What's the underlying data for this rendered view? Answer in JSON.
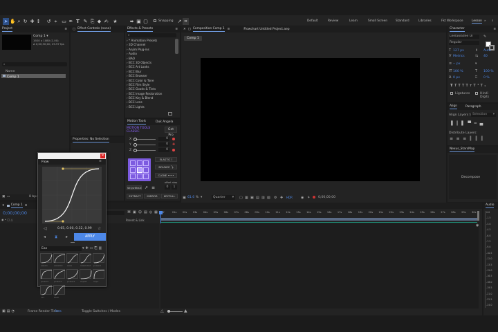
{
  "toolbar": {
    "snapping_label": "Snapping",
    "workspaces": [
      "Default",
      "Review",
      "Learn",
      "Small Screen",
      "Standard",
      "Libraries",
      "Fkt Workspace",
      "Lesson"
    ]
  },
  "project": {
    "title": "Project",
    "comp_name": "Comp 1 ▾",
    "comp_info1": "1920 x 1080 (1.00)",
    "comp_info2": "Δ 0;00;30;00, 29.97 fps",
    "col_name": "Name",
    "item": "Comp 1",
    "bpc": "8 bpc"
  },
  "effect_controls": {
    "title": "Effect Controls (none)"
  },
  "properties": {
    "title": "Properties: No Selection"
  },
  "effects": {
    "title": "Effects & Presets",
    "items": [
      "* Animation Presets",
      "3D Channel",
      "Anjim Plug-ins",
      "Audio",
      "BAO",
      "BCC 3D Objects",
      "BCC Art Looks",
      "BCC Blur",
      "BCC Browser",
      "BCC Color & Tone",
      "BCC Film Style",
      "BCC Goods & Tints",
      "BCC Image Restoration",
      "BCC Key & Blend",
      "BCC Lens",
      "BCC Lights"
    ]
  },
  "motion": {
    "tab1": "Motion Tools",
    "tab2": "Duk Angela",
    "title1": "MOTION TOOLS",
    "title2": "CLASSIC",
    "get_pro": "Get Pro",
    "x": "X",
    "y": "Y",
    "z": "Z",
    "v0": "0",
    "v1": "0",
    "v2": "0",
    "elastic": "ELASTIC",
    "bounce": "BOUNCE",
    "clone": "CLONE",
    "sequence": "SEQUENCE",
    "offset": "offset",
    "step": "step",
    "offset_val": "0",
    "step_val": "1",
    "extract": "EXTRACT",
    "mirror": "MIRROR",
    "keyframe": "KEYFULL"
  },
  "composition": {
    "tab": "Composition Comp 1",
    "project_file": "Flowchart Untitled Project.aep",
    "subtab": "Comp 1",
    "zoom": "61.6",
    "quality": "Quarter",
    "timecode": "0;00;00;00",
    "hdr": "HDR"
  },
  "character": {
    "title": "Character",
    "font": "Leelawadee UI",
    "style": "Regular",
    "size": "127 px",
    "leading": "Auto",
    "tracking_label": "Metrics",
    "tracking": "40",
    "stroke": "-- px",
    "scale_v": "100 %",
    "scale_h": "100 %",
    "baseline": "0 px",
    "tsume": "0 %",
    "ligatures": "Ligatures",
    "hindi": "Hindi Digits"
  },
  "align": {
    "tab1": "Align",
    "tab2": "Paragraph",
    "layers_to": "Align Layers to:",
    "selection": "Selection",
    "distribute": "Distribute Layers:"
  },
  "nexus": {
    "title": "Nexus_StarsMap",
    "decompose": "Decompose"
  },
  "timeline": {
    "tab": "Comp 1",
    "timecode": "0;00;00;00",
    "col_parent": "Parent & Link",
    "ticks": [
      "0f",
      "01s",
      "02s",
      "03s",
      "04s",
      "05s",
      "06s",
      "07s",
      "08s",
      "09s",
      "10s",
      "11s",
      "12s",
      "13s",
      "14s",
      "15s",
      "16s",
      "17s",
      "18s",
      "19s",
      "20s",
      "21s",
      "22s",
      "23s",
      "24s",
      "25s",
      "26s",
      "27s",
      "28s",
      "29s",
      "30s"
    ],
    "render_label": "Frame Render Time:",
    "render_value": "0ms",
    "toggle": "Toggle Switches / Modes"
  },
  "audio": {
    "title": "Audio",
    "levels": [
      "0.0",
      "-1.5",
      "-3.0",
      "-4.5",
      "-6.0",
      "-7.5",
      "-9.0",
      "-10.5",
      "-12.0",
      "-13.5",
      "-15.0",
      "-16.5",
      "-18.0",
      "-19.5",
      "-21.0",
      "-22.5",
      "-24.0"
    ]
  },
  "flow": {
    "title": "Flow",
    "bezier": "0.65, 0.00, 0.32, 0.99",
    "apply": "APPLY",
    "search": "Eas",
    "presets": [
      "easeIn",
      "easeOut",
      "ease",
      "easeInOut",
      "power1",
      "power2",
      "power3",
      "power4",
      "expoIn",
      "expo",
      "circ",
      "back"
    ]
  },
  "colors": {
    "accent": "#4d88e8",
    "purple": "#7d5be0",
    "curve": "#e3c463",
    "selected": "#6f9be0"
  }
}
